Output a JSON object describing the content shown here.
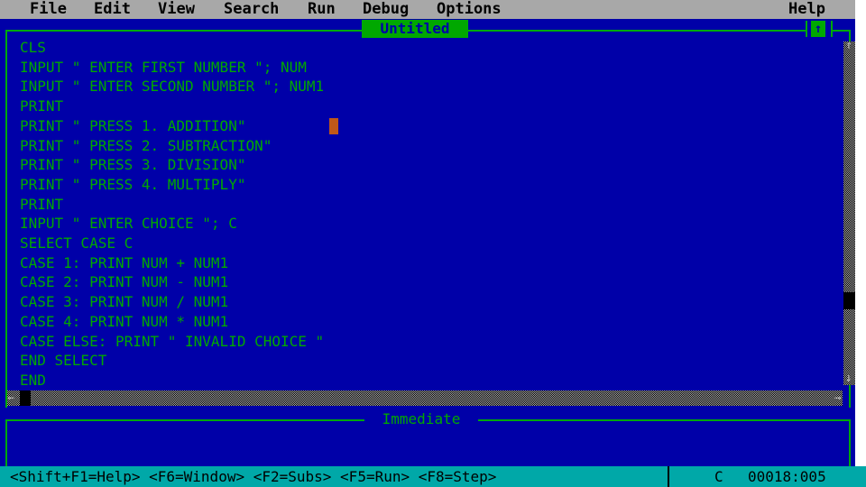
{
  "menu": {
    "items": [
      "File",
      "Edit",
      "View",
      "Search",
      "Run",
      "Debug",
      "Options"
    ],
    "help": "Help"
  },
  "editor": {
    "title": "Untitled",
    "lines": [
      "CLS",
      "INPUT \" ENTER FIRST NUMBER \"; NUM",
      "INPUT \" ENTER SECOND NUMBER \"; NUM1",
      "PRINT",
      "PRINT \" PRESS 1. ADDITION\"",
      "PRINT \" PRESS 2. SUBTRACTION\"",
      "PRINT \" PRESS 3. DIVISION\"",
      "PRINT \" PRESS 4. MULTIPLY\"",
      "PRINT",
      "INPUT \" ENTER CHOICE \"; C",
      "SELECT CASE C",
      "CASE 1: PRINT NUM + NUM1",
      "CASE 2: PRINT NUM - NUM1",
      "CASE 3: PRINT NUM / NUM1",
      "CASE 4: PRINT NUM * NUM1",
      "CASE ELSE: PRINT \" INVALID CHOICE \"",
      "END SELECT",
      "END"
    ],
    "maximize_glyph": "↑",
    "arrows": {
      "up": "↑",
      "down": "↓",
      "left": "←",
      "right": "→"
    }
  },
  "immediate": {
    "title": "Immediate"
  },
  "status": {
    "hints": "<Shift+F1=Help> <F6=Window> <F2=Subs> <F5=Run> <F8=Step>",
    "caps": "C",
    "position": "00018:005"
  },
  "colors": {
    "background": "#0000a8",
    "text": "#00a800",
    "menu_bg": "#a8a8a8",
    "status_bg": "#00a8a8",
    "cursor": "#c05818"
  }
}
